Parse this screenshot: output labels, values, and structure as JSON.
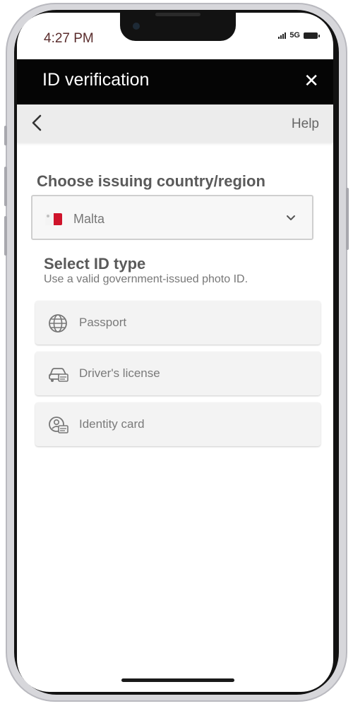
{
  "status_bar": {
    "time": "4:27 PM",
    "network": "5G"
  },
  "header": {
    "title": "ID verification",
    "close_icon": "close-icon"
  },
  "nav": {
    "back_icon": "chevron-left-icon",
    "help_label": "Help"
  },
  "country": {
    "section_title": "Choose issuing country/region",
    "selected": "Malta",
    "flag_icon": "malta-flag-icon",
    "dropdown_icon": "chevron-down-icon"
  },
  "id_type": {
    "title": "Select ID type",
    "subtitle": "Use a valid government-issued photo ID.",
    "options": [
      {
        "label": "Passport",
        "icon": "globe-icon"
      },
      {
        "label": "Driver's license",
        "icon": "car-icon"
      },
      {
        "label": "Identity card",
        "icon": "id-card-icon"
      }
    ]
  },
  "colors": {
    "header_bg": "#050505",
    "nav_bg": "#ececec",
    "flag_red": "#cf142b"
  }
}
